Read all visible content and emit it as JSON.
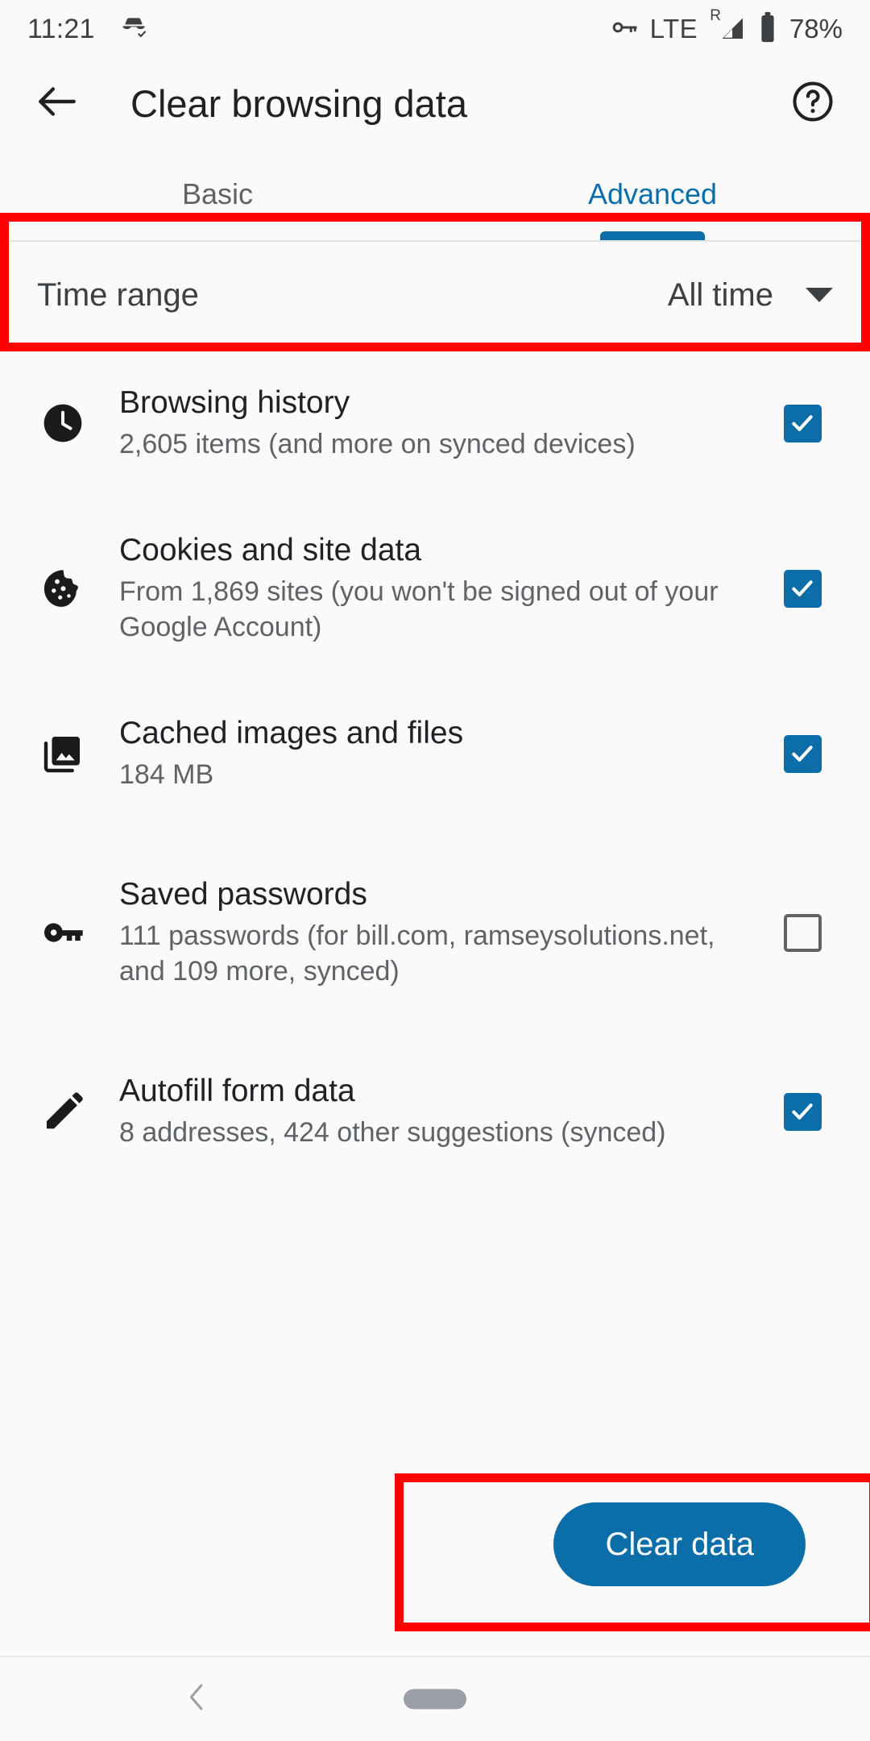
{
  "status_bar": {
    "time": "11:21",
    "icons_left": [
      "incognito-mask-check-icon"
    ],
    "icons_right": [
      "vpn-key-icon",
      "signal-icon",
      "battery-icon"
    ],
    "network_label": "LTE",
    "roaming_label": "R",
    "battery_percent": "78%"
  },
  "app_bar": {
    "back_icon": "back-arrow-icon",
    "title": "Clear browsing data",
    "help_icon": "help-circle-icon"
  },
  "tabs": [
    {
      "label": "Basic",
      "active": false
    },
    {
      "label": "Advanced",
      "active": true
    }
  ],
  "time_range": {
    "label": "Time range",
    "value": "All time",
    "caret_icon": "chevron-down-icon"
  },
  "data_rows": [
    {
      "icon": "clock-icon",
      "title": "Browsing history",
      "subtitle": "2,605 items (and more on synced devices)",
      "checked": true
    },
    {
      "icon": "cookie-icon",
      "title": "Cookies and site data",
      "subtitle": "From 1,869 sites (you won't be signed out of your Google Account)",
      "checked": true
    },
    {
      "icon": "image-stack-icon",
      "title": "Cached images and files",
      "subtitle": "184 MB",
      "checked": true
    },
    {
      "icon": "key-icon",
      "title": "Saved passwords",
      "subtitle": "111 passwords (for bill.com, ramseysolutions.net, and 109 more, synced)",
      "checked": false
    },
    {
      "icon": "pencil-icon",
      "title": "Autofill form data",
      "subtitle": "8 addresses, 424 other suggestions (synced)",
      "checked": true
    }
  ],
  "primary_action": {
    "label": "Clear data"
  },
  "nav_bar": {
    "back_icon": "nav-back-chevron-icon",
    "home_icon": "nav-home-pill-icon"
  },
  "colors": {
    "accent": "#0b6ea8",
    "highlight": "#ff0000",
    "background": "#fafafa",
    "title_text": "#202124",
    "secondary_text": "#5f6368"
  },
  "annotations": [
    {
      "name": "time-range-highlight",
      "target": "time_range"
    },
    {
      "name": "clear-data-highlight",
      "target": "primary_action"
    }
  ]
}
